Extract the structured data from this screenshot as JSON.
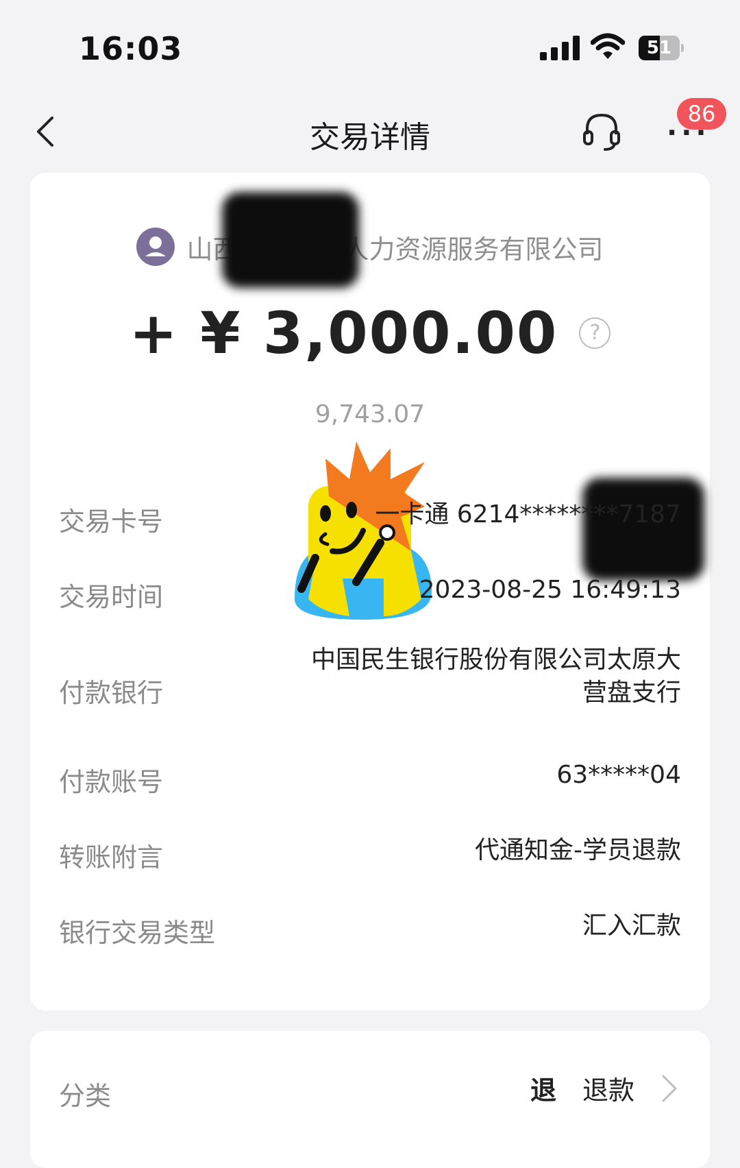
{
  "status_bar": {
    "time": "16:03",
    "battery": 51
  },
  "nav": {
    "title": "交易详情",
    "badge": "86"
  },
  "transaction": {
    "merchant_name": "山西文悦嘉和人力资源服务有限公司",
    "amount": "+ ¥ 3,000.00",
    "balance": "9,743.07"
  },
  "details": [
    {
      "label": "交易卡号",
      "value": "一卡通 6214********7187"
    },
    {
      "label": "交易时间",
      "value": "2023-08-25 16:49:13"
    },
    {
      "label": "付款银行",
      "value": "中国民生银行股份有限公司太原大",
      "value2": "营盘支行"
    },
    {
      "label": "付款账号",
      "value": "63*****04"
    },
    {
      "label": "转账附言",
      "value": "代通知金-学员退款"
    },
    {
      "label": "银行交易类型",
      "value": "汇入汇款"
    }
  ],
  "category": {
    "label": "分类",
    "icon_text": "退",
    "value": "退款"
  }
}
